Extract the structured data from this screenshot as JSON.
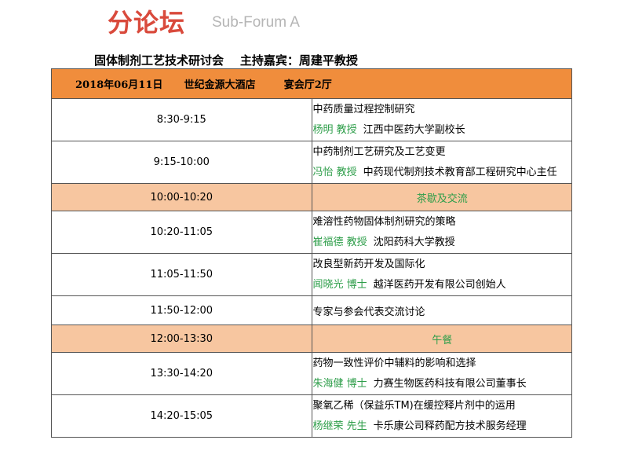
{
  "header": {
    "title_cn": "分论坛",
    "title_en": "Sub-Forum A",
    "subtitle": "固体制剂工艺技术研讨会    主持嘉宾：周建平教授"
  },
  "table": {
    "head": {
      "date": "2018年06月11日",
      "venue": "世纪金源大酒店",
      "hall": "宴会厅2厅"
    },
    "rows": [
      {
        "time": "8:30-9:15",
        "topic": "中药质量过程控制研究",
        "speaker": "杨明 教授",
        "affiliation": "江西中医药大学副校长"
      },
      {
        "time": "9:15-10:00",
        "topic": "中药制剂工艺研究及工艺变更",
        "speaker": "冯怡 教授",
        "affiliation": "中药现代制剂技术教育部工程研究中心主任"
      },
      {
        "time": "10:00-10:20",
        "break": "茶歇及交流"
      },
      {
        "time": "10:20-11:05",
        "topic": "难溶性药物固体制剂研究的策略",
        "speaker": "崔福德 教授",
        "affiliation": "沈阳药科大学教授"
      },
      {
        "time": "11:05-11:50",
        "topic": "改良型新药开发及国际化",
        "speaker": "闻晓光 博士",
        "affiliation": "越洋医药开发有限公司创始人"
      },
      {
        "time": "11:50-12:00",
        "topic": "专家与参会代表交流讨论"
      },
      {
        "time": "12:00-13:30",
        "break": "午餐"
      },
      {
        "time": "13:30-14:20",
        "topic": "药物一致性评价中辅料的影响和选择",
        "speaker": "朱海健 博士",
        "affiliation": "力赛生物医药科技有限公司董事长"
      },
      {
        "time": "14:20-15:05",
        "topic": "聚氧乙稀（保益乐TM)在缓控释片剂中的运用",
        "speaker": "杨继荣 先生",
        "affiliation": "卡乐康公司释药配方技术服务经理"
      }
    ]
  },
  "colors": {
    "title_red": "#d94a3c",
    "header_orange": "#f08d3c",
    "break_peach": "#f7c6a0",
    "speaker_green": "#2e9e4a"
  }
}
